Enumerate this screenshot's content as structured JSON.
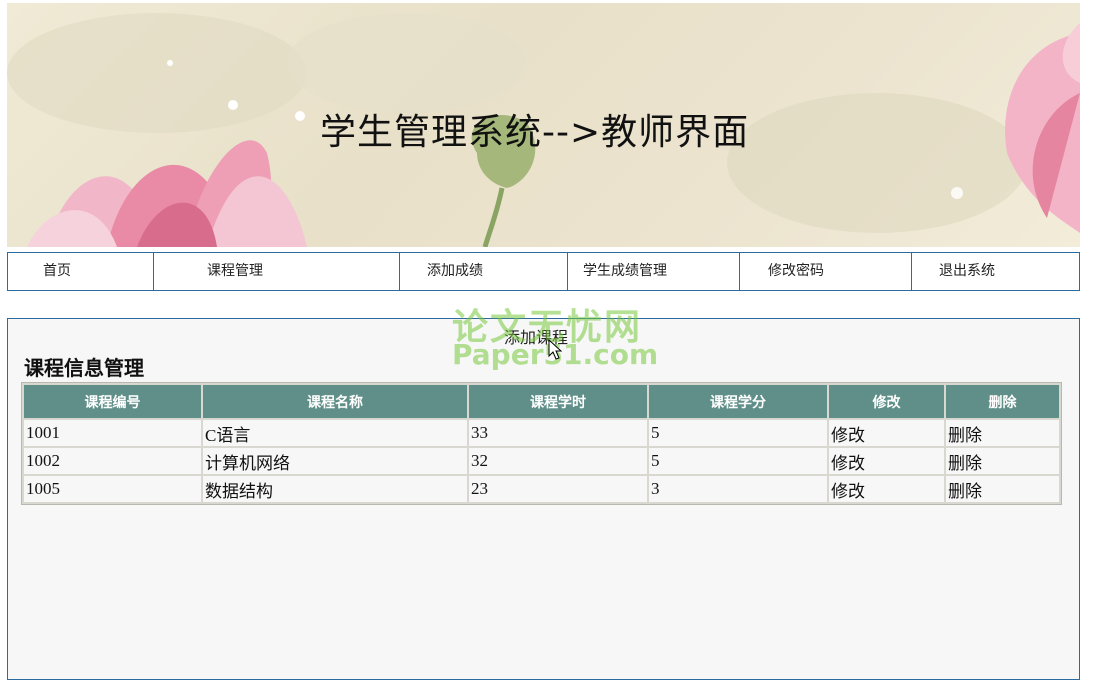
{
  "banner": {
    "title": "学生管理系统-->教师界面"
  },
  "nav": {
    "items": [
      {
        "label": "首页"
      },
      {
        "label": "课程管理"
      },
      {
        "label": "添加成绩"
      },
      {
        "label": "学生成绩管理"
      },
      {
        "label": "修改密码"
      },
      {
        "label": "退出系统"
      }
    ]
  },
  "content": {
    "add_link": "添加课程",
    "section_title": "课程信息管理",
    "table": {
      "headers": [
        "课程编号",
        "课程名称",
        "课程学时",
        "课程学分",
        "修改",
        "删除"
      ],
      "rows": [
        [
          "1001",
          "C语言",
          "33",
          "5",
          "修改",
          "删除"
        ],
        [
          "1002",
          "计算机网络",
          "32",
          "5",
          "修改",
          "删除"
        ],
        [
          "1005",
          "数据结构",
          "23",
          "3",
          "修改",
          "删除"
        ]
      ]
    }
  },
  "watermark": {
    "line1": "论文无忧网",
    "line2": "Paper51.com"
  },
  "colors": {
    "nav_border": "#2d6aa0",
    "table_header": "#5f8f88",
    "banner_bg": "#ece4cf"
  }
}
